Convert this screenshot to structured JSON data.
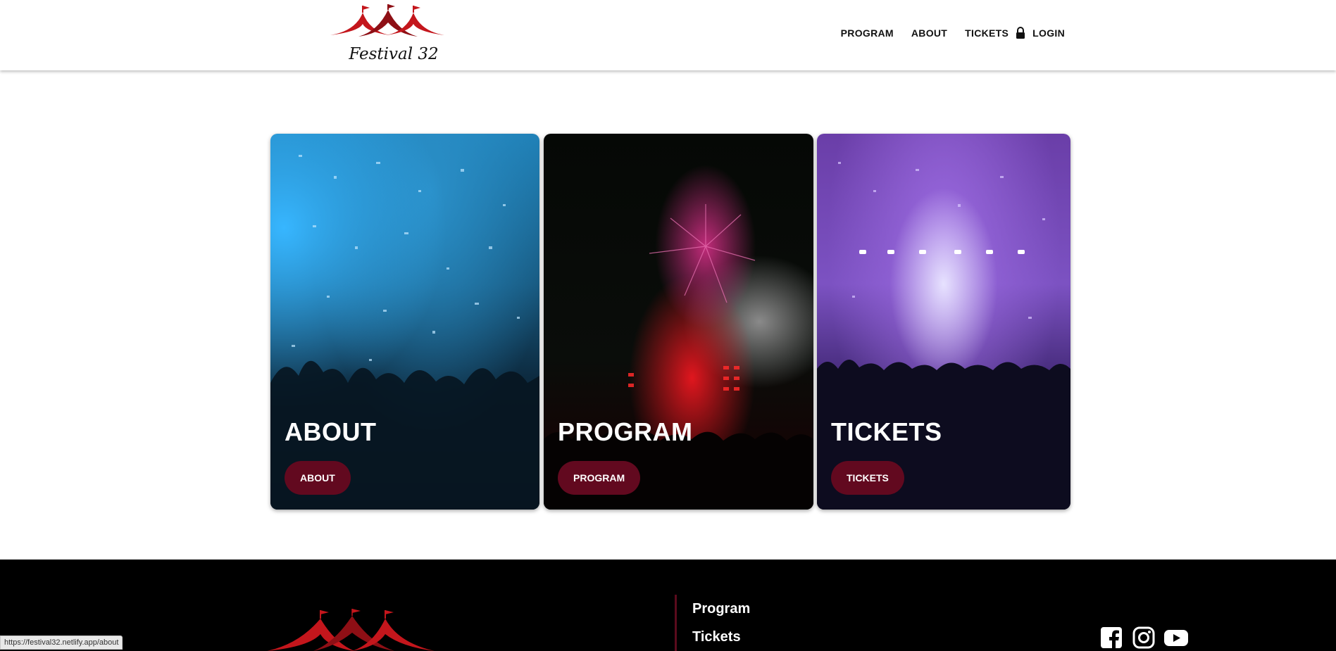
{
  "brand": {
    "name": "Festival 32",
    "logo_color": "#c4161c"
  },
  "nav": {
    "program": "PROGRAM",
    "about": "ABOUT",
    "tickets": "TICKETS",
    "login": "LOGIN"
  },
  "cards": [
    {
      "title": "ABOUT",
      "button": "ABOUT"
    },
    {
      "title": "PROGRAM",
      "button": "PROGRAM"
    },
    {
      "title": "TICKETS",
      "button": "TICKETS"
    }
  ],
  "colors": {
    "button_bg": "#62091f",
    "footer_bg": "#000000",
    "divider": "#5b0b1d"
  },
  "footer": {
    "links": [
      "Program",
      "Tickets"
    ],
    "social_icons": [
      "facebook-icon",
      "instagram-icon",
      "youtube-icon"
    ]
  },
  "status_bar": {
    "url": "https://festival32.netlify.app/about"
  }
}
